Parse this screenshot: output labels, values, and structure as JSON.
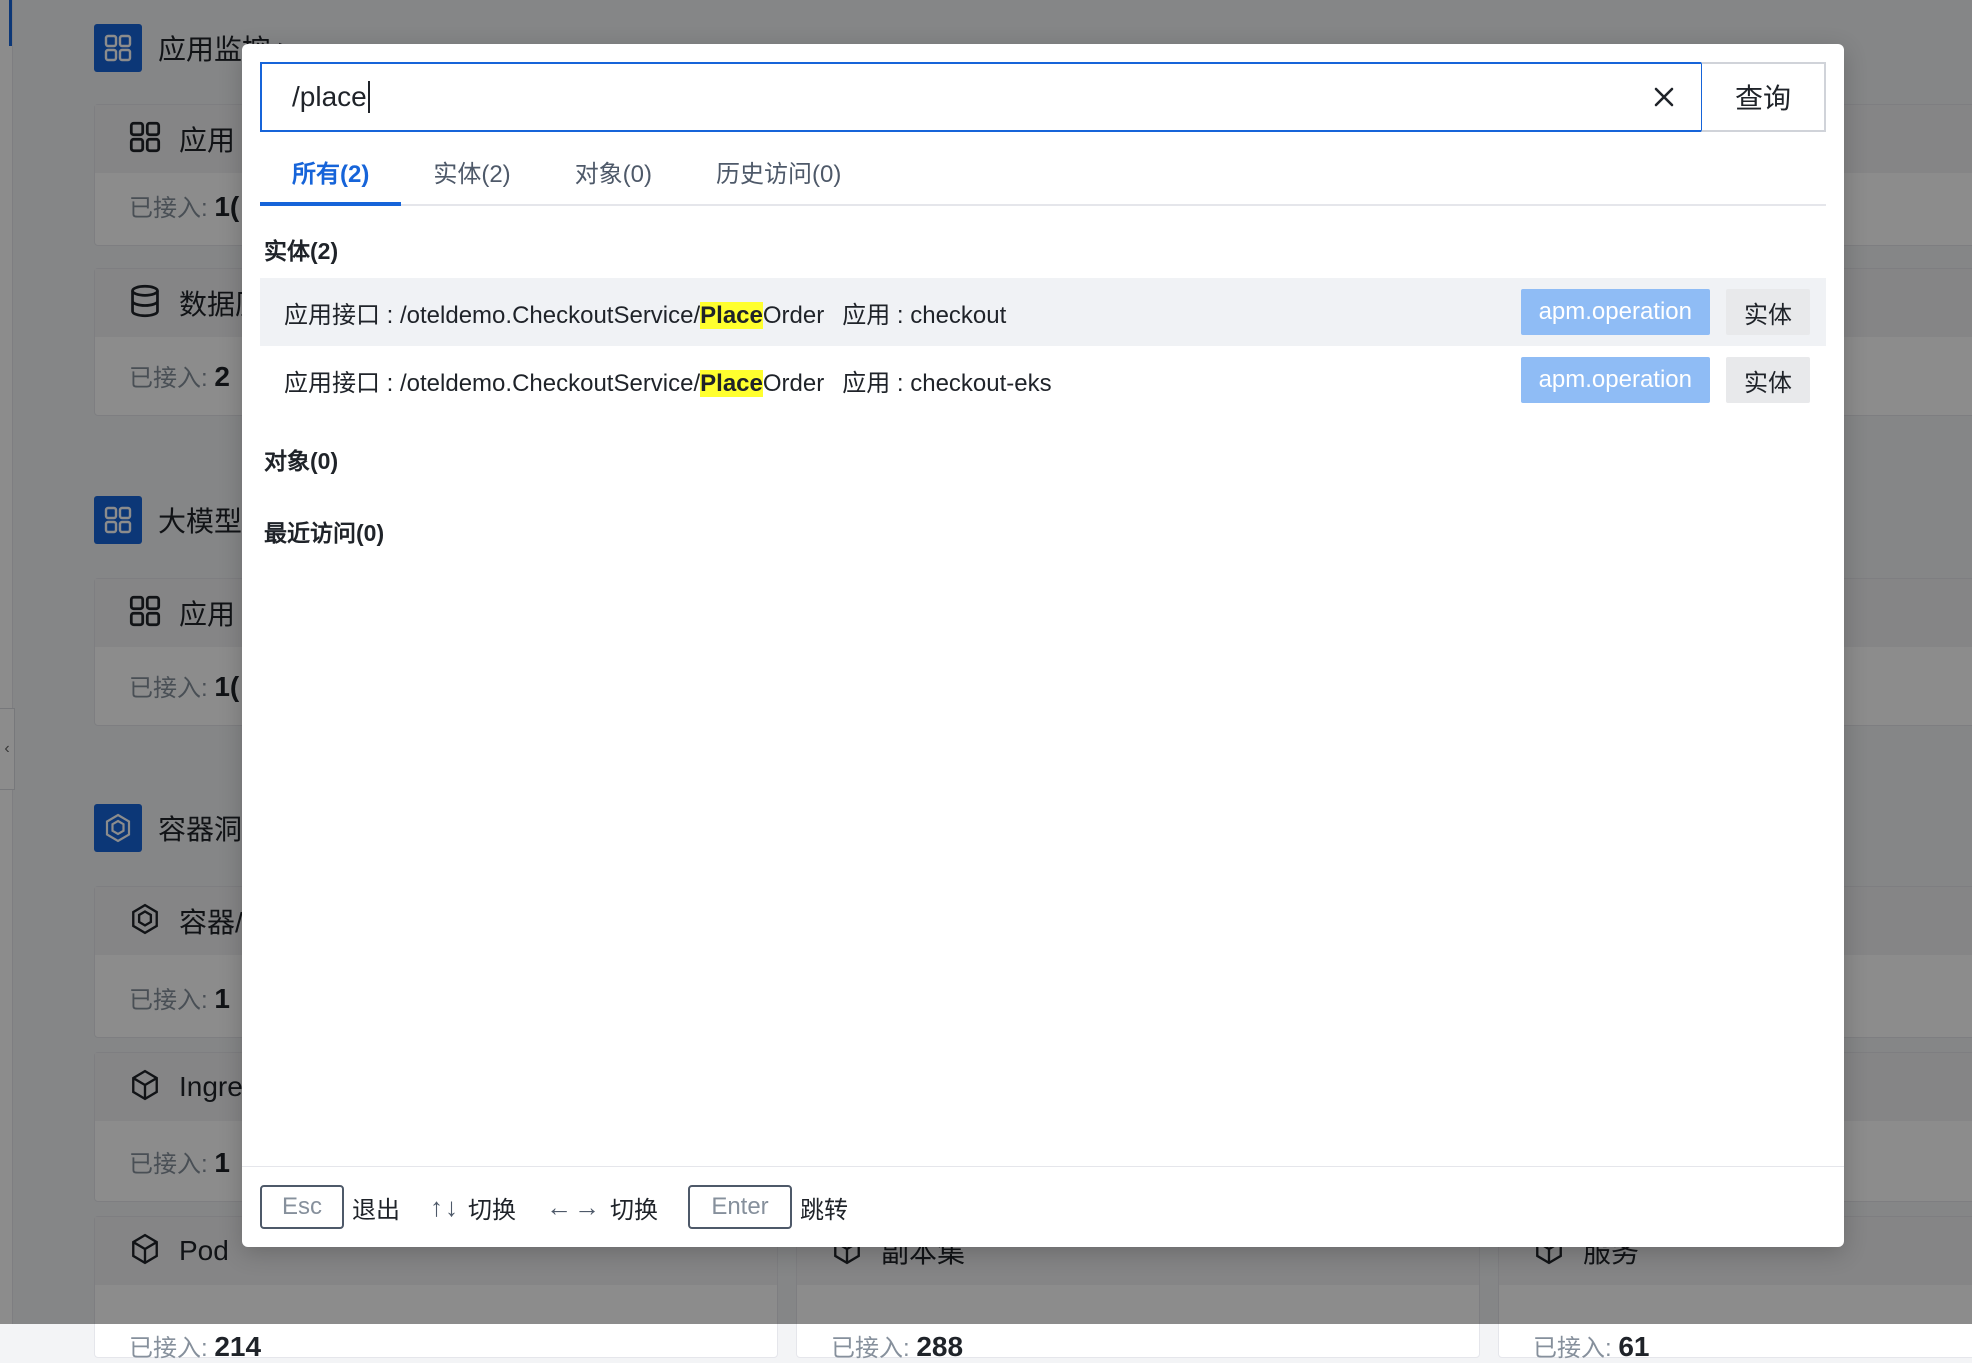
{
  "background": {
    "sections": [
      {
        "title": "应用监控 >"
      },
      {
        "title": "大模型"
      },
      {
        "title": "容器洞"
      }
    ],
    "cards": [
      {
        "title": "应用",
        "label": "已接入:",
        "value": "1("
      },
      {
        "title": "数据历",
        "label": "已接入:",
        "value": "2"
      },
      {
        "title": "应用",
        "label": "已接入:",
        "value": "1("
      },
      {
        "title": "容器/",
        "label": "已接入:",
        "value": "1"
      },
      {
        "title": "Ingre",
        "label": "已接入:",
        "value": "1"
      },
      {
        "title": "Pod",
        "label": "已接入:",
        "value": "214"
      },
      {
        "title": "副本集",
        "label": "已接入:",
        "value": "288"
      },
      {
        "title": "服务",
        "label": "已接入:",
        "value": "61"
      }
    ]
  },
  "search": {
    "value": "/place",
    "query_label": "查询"
  },
  "tabs": [
    {
      "label": "所有(2)",
      "active": true
    },
    {
      "label": "实体(2)",
      "active": false
    },
    {
      "label": "对象(0)",
      "active": false
    },
    {
      "label": "历史访问(0)",
      "active": false
    }
  ],
  "groups": {
    "entity": "实体(2)",
    "object": "对象(0)",
    "recent": "最近访问(0)"
  },
  "results": [
    {
      "prefix": "应用接口 : /oteldemo.CheckoutService/",
      "highlight": "Place",
      "suffix": "Order",
      "app": "应用 : checkout",
      "type_tag": "apm.operation",
      "kind_tag": "实体"
    },
    {
      "prefix": "应用接口 : /oteldemo.CheckoutService/",
      "highlight": "Place",
      "suffix": "Order",
      "app": "应用 : checkout-eks",
      "type_tag": "apm.operation",
      "kind_tag": "实体"
    }
  ],
  "footer": {
    "esc_key": "Esc",
    "esc_hint": "退出",
    "updown_arrows": "↑↓",
    "updown_hint": "切换",
    "leftright_arrows": "←→",
    "leftright_hint": "切换",
    "enter_key": "Enter",
    "enter_hint": "跳转"
  },
  "colors": {
    "primary": "#1664d9",
    "tag_type_bg": "#8fbcf5",
    "highlight": "#ffff2e"
  }
}
